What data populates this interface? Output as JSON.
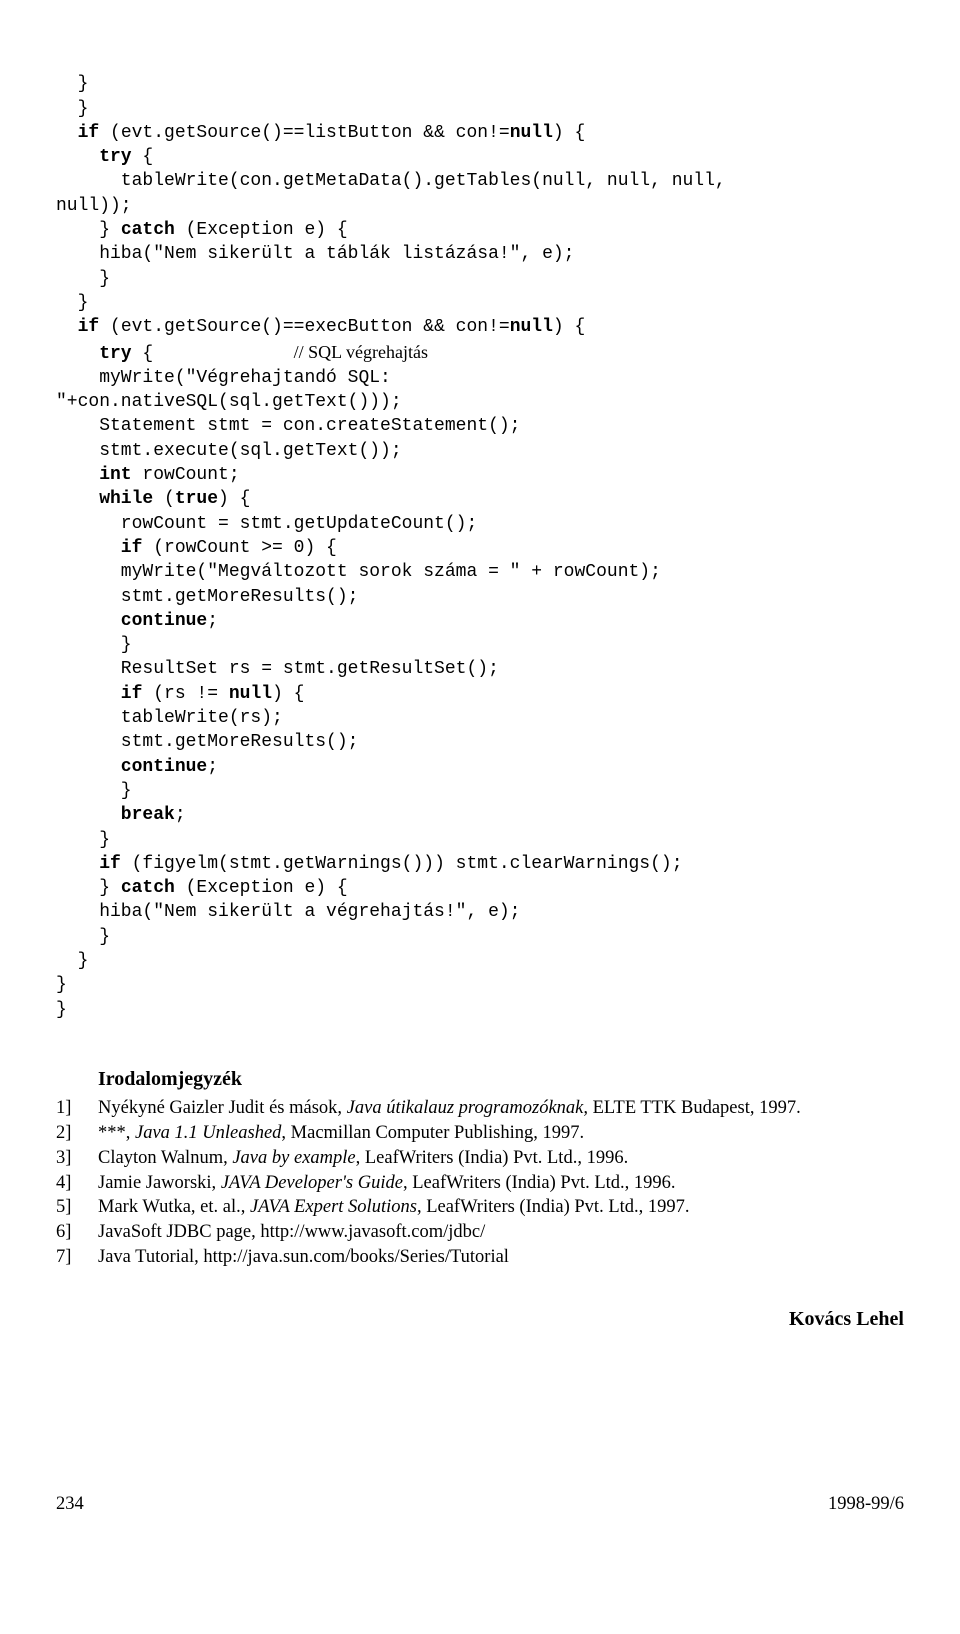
{
  "code": {
    "l00": "  }",
    "l01": "  }",
    "l02a": "  if",
    "l02b": " (evt.getSource()==listButton && con!=",
    "l02c": "null",
    "l02d": ") {",
    "l03a": "    try",
    "l03b": " {",
    "l04": "      tableWrite(con.getMetaData().getTables(null, null, null,",
    "l05": "null));",
    "l06a": "    } ",
    "l06b": "catch",
    "l06c": " (Exception e) {",
    "l07": "    hiba(\"Nem sikerült a táblák listázása!\", e);",
    "l08": "    }",
    "l09": "  }",
    "l10a": "  if",
    "l10b": " (evt.getSource()==execButton && con!=",
    "l10c": "null",
    "l10d": ") {",
    "l11a": "    try",
    "l11b": " {             ",
    "l11c": "// SQL végrehajtás",
    "l12": "    myWrite(\"Végrehajtandó SQL:",
    "l13": "\"+con.nativeSQL(sql.getText()));",
    "l14": "    Statement stmt = con.createStatement();",
    "l15": "    stmt.execute(sql.getText());",
    "l16a": "    int",
    "l16b": " rowCount;",
    "l17a": "    while",
    "l17b": " (",
    "l17c": "true",
    "l17d": ") {",
    "l18": "      rowCount = stmt.getUpdateCount();",
    "l19a": "      if",
    "l19b": " (rowCount >= 0) {",
    "l20": "      myWrite(\"Megváltozott sorok száma = \" + rowCount);",
    "l21": "      stmt.getMoreResults();",
    "l22a": "      continue",
    "l22b": ";",
    "l23": "      }",
    "l24": "      ResultSet rs = stmt.getResultSet();",
    "l25a": "      if",
    "l25b": " (rs != ",
    "l25c": "null",
    "l25d": ") {",
    "l26": "      tableWrite(rs);",
    "l27": "      stmt.getMoreResults();",
    "l28a": "      continue",
    "l28b": ";",
    "l29": "      }",
    "l30a": "      break",
    "l30b": ";",
    "l31": "    }",
    "l32a": "    if",
    "l32b": " (figyelm(stmt.getWarnings())) stmt.clearWarnings();",
    "l33a": "    } ",
    "l33b": "catch",
    "l33c": " (Exception e) {",
    "l34": "    hiba(\"Nem sikerült a végrehajtás!\", e);",
    "l35": "    }",
    "l36": "  }",
    "l37": "}",
    "l38": "}"
  },
  "refs": {
    "title": "Irodalomjegyzék",
    "items": [
      {
        "n": "1]",
        "pre": "Nyékyné Gaizler Judit és mások, ",
        "i": "Java útikalauz programozóknak, ",
        "post": "ELTE TTK Budapest, 1997."
      },
      {
        "n": "2]",
        "pre": "***, ",
        "i": "Java 1.1 Unleashed",
        "post": ", Macmillan Computer Publishing, 1997."
      },
      {
        "n": "3]",
        "pre": "Clayton Walnum, ",
        "i": "Java by example",
        "post": ", LeafWriters (India) Pvt. Ltd., 1996."
      },
      {
        "n": "4]",
        "pre": "Jamie Jaworski, ",
        "i": "JAVA Developer's Guide",
        "post": ", LeafWriters (India) Pvt. Ltd., 1996."
      },
      {
        "n": "5]",
        "pre": "Mark Wutka, et. al., ",
        "i": "JAVA Expert Solutions",
        "post": ", LeafWriters (India) Pvt. Ltd., 1997."
      },
      {
        "n": "6]",
        "pre": "JavaSoft JDBC page, http://www.javasoft.com/jdbc/",
        "i": "",
        "post": ""
      },
      {
        "n": "7]",
        "pre": "Java Tutorial, http://java.sun.com/books/Series/Tutorial",
        "i": "",
        "post": ""
      }
    ]
  },
  "author": "Kovács Lehel",
  "footer": {
    "left": "234",
    "right": "1998-99/6"
  }
}
